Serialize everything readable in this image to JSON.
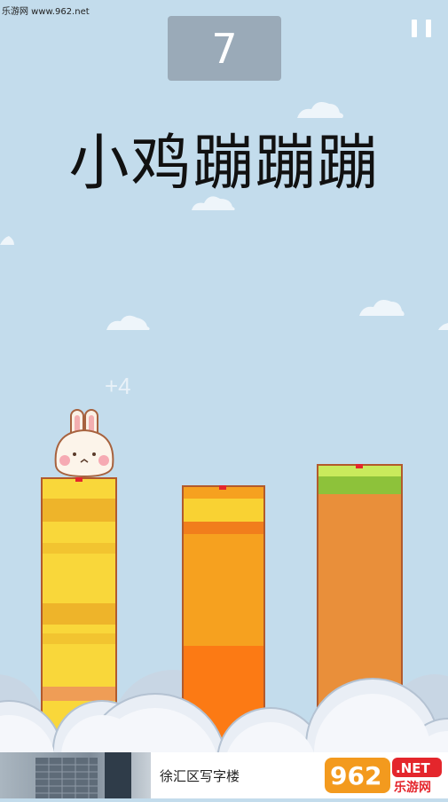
{
  "watermark": "乐游网 www.962.net",
  "score": "7",
  "title": "小鸡蹦蹦蹦",
  "bonus": "+4",
  "ad": {
    "text": "徐汇区写字楼",
    "logo_main": "962",
    "logo_net": ".NET",
    "logo_sub": "乐游网"
  },
  "colors": {
    "sky": "#c3dcec",
    "pillar_yellow": "#f9d73a",
    "pillar_orange": "#f6a11f",
    "pillar_tan": "#e98f3a",
    "grass": "#9fd22e",
    "marker": "#e4262c"
  },
  "icons": [
    "pause-icon",
    "bunny-character",
    "cloud-icon"
  ]
}
